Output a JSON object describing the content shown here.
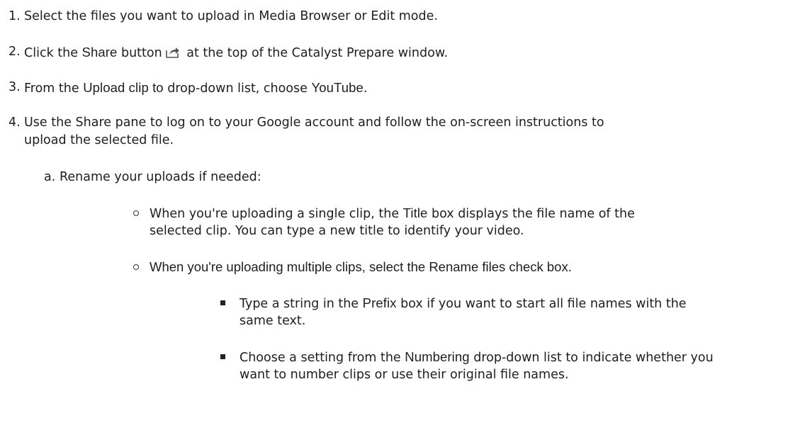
{
  "steps": [
    {
      "number": "1.",
      "text": "Select the files you want to upload in Media Browser or Edit mode."
    },
    {
      "number": "2.",
      "pre": "Click the ",
      "bold": "Share",
      "mid": " button",
      "icon": "share-icon",
      "post": " at the top of the Catalyst Prepare window."
    },
    {
      "number": "3.",
      "pre": "From the ",
      "bold1": "Upload clip to",
      "mid": " drop-down list, choose ",
      "bold2": "YouTube",
      "post": "."
    },
    {
      "number": "4.",
      "line1": "Use the Share pane to log on to your Google account and follow the on-screen instructions to",
      "line2": "upload the selected file."
    }
  ],
  "substep_a": {
    "letter": "a.",
    "text": "Rename your uploads if needed:"
  },
  "bullets": [
    {
      "pre": "When you're uploading a single clip, the ",
      "bold": "Title",
      "post": " box displays the file name of the",
      "line2": "selected clip. You can type a new title to identify your video."
    },
    {
      "pre": "When you're uploading multiple clips, select the ",
      "bold": "Rename files",
      "post": " check box."
    }
  ],
  "subbullets": [
    {
      "pre": "Type a string in the ",
      "bold": "Prefix",
      "post": " box if you want to start all file names with the",
      "line2": "same text."
    },
    {
      "pre": "Choose a setting from the ",
      "bold": "Numbering",
      "post": " drop-down list to indicate whether you",
      "line2": "want to number clips or use their original file names."
    }
  ]
}
